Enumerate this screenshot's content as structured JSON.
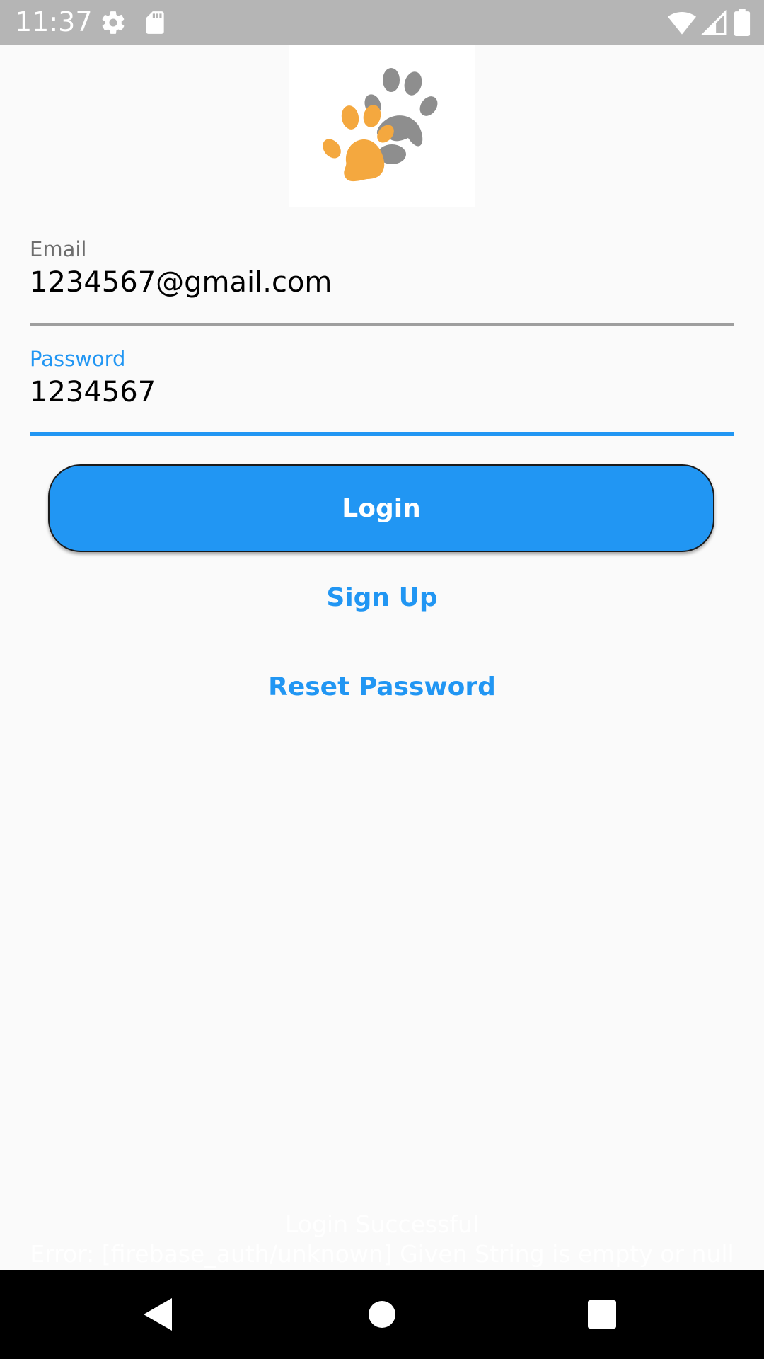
{
  "status_bar": {
    "time": "11:37",
    "icons": [
      "settings-icon",
      "sd-card-icon",
      "wifi-icon",
      "signal-icon",
      "battery-icon"
    ]
  },
  "logo": {
    "icon": "paw-prints-icon",
    "colors": {
      "orange": "#f4a83f",
      "gray": "#8e8e8e"
    }
  },
  "form": {
    "email": {
      "label": "Email",
      "value": "1234567@gmail.com"
    },
    "password": {
      "label": "Password",
      "value": "1234567"
    }
  },
  "buttons": {
    "login": "Login",
    "sign_up": "Sign Up",
    "reset_password": "Reset Password"
  },
  "toast": {
    "line1": "Login Successful",
    "line2": "Error: [firebase_auth/unknown] Given String is empty or null"
  },
  "nav_bar": {
    "icons": [
      "back-icon",
      "home-icon",
      "recents-icon"
    ]
  },
  "colors": {
    "accent": "#2196f3",
    "status_bar": "#b5b5b5",
    "background": "#fafafa"
  }
}
